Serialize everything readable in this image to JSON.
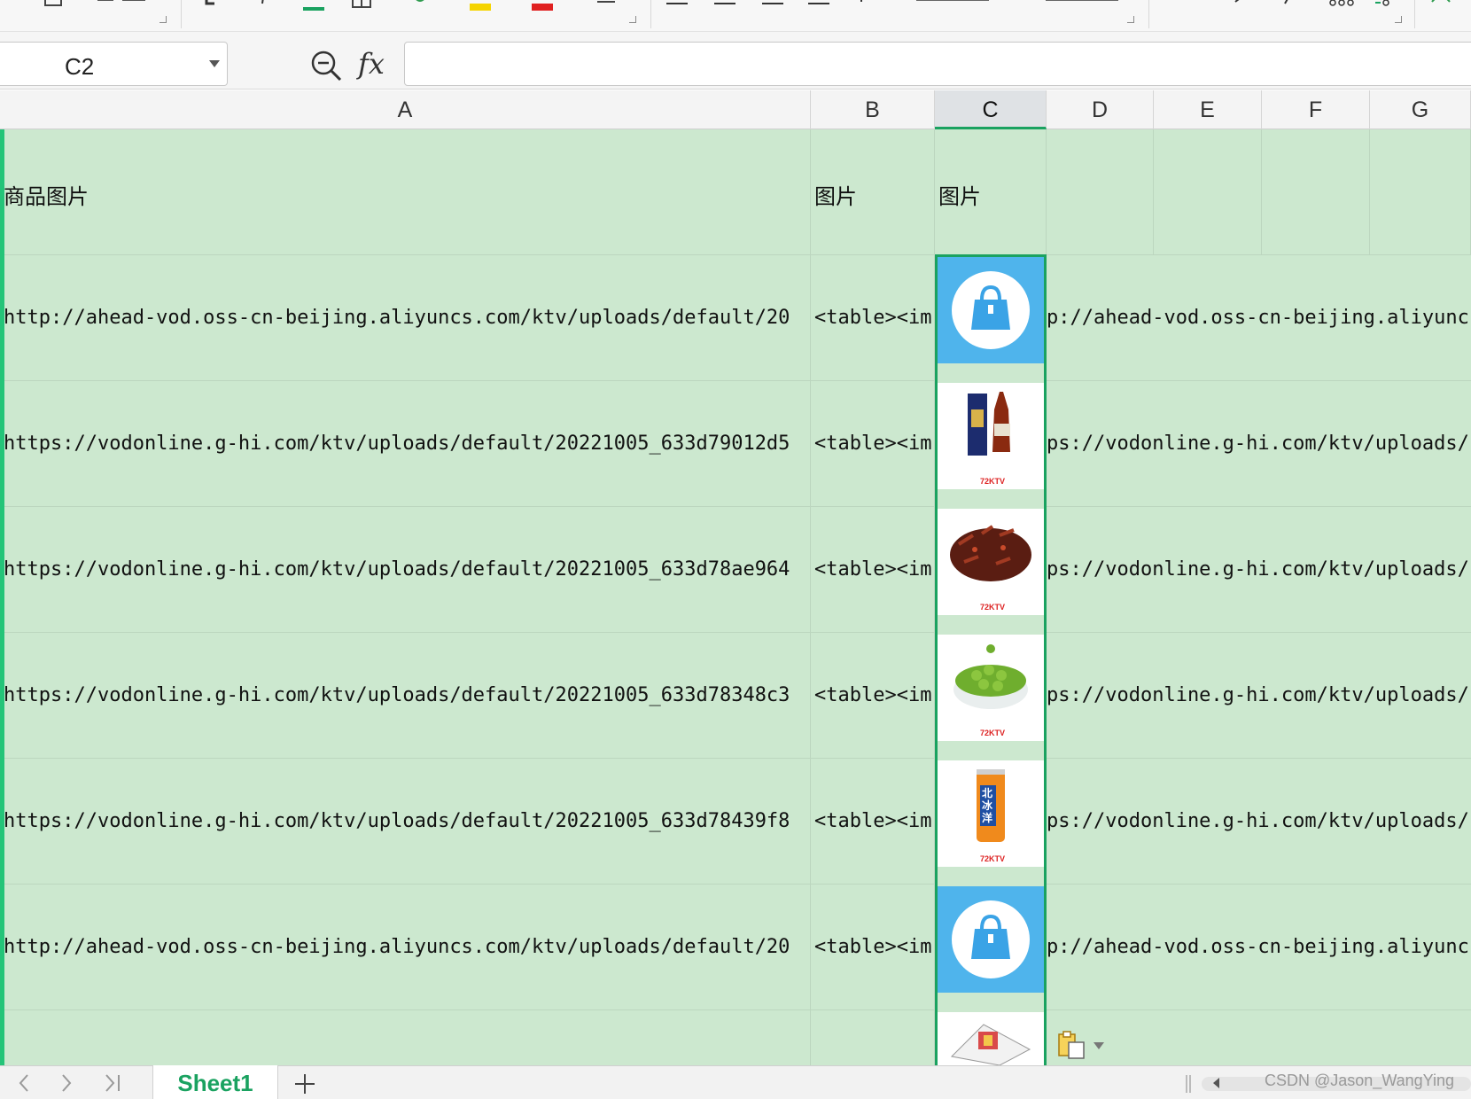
{
  "formula_bar": {
    "cell_ref": "C2",
    "fx_label": "fx",
    "formula_value": ""
  },
  "columns": [
    {
      "id": "A",
      "label": "A"
    },
    {
      "id": "B",
      "label": "B"
    },
    {
      "id": "C",
      "label": "C"
    },
    {
      "id": "D",
      "label": "D"
    },
    {
      "id": "E",
      "label": "E"
    },
    {
      "id": "F",
      "label": "F"
    },
    {
      "id": "G",
      "label": "G"
    }
  ],
  "selected_column": "C",
  "header_row": {
    "a": "商品图片",
    "b": "图片",
    "c": "图片"
  },
  "rows": [
    {
      "a": "http://ahead-vod.oss-cn-beijing.aliyuncs.com/ktv/uploads/default/20",
      "b": "<table><im",
      "d": "p://ahead-vod.oss-cn-beijing.aliyunc",
      "thumb": "bag"
    },
    {
      "a": "https://vodonline.g-hi.com/ktv/uploads/default/20221005_633d79012d5",
      "b": "<table><im",
      "d": "ps://vodonline.g-hi.com/ktv/uploads/",
      "thumb": "cognac"
    },
    {
      "a": "https://vodonline.g-hi.com/ktv/uploads/default/20221005_633d78ae964",
      "b": "<table><im",
      "d": "ps://vodonline.g-hi.com/ktv/uploads/",
      "thumb": "meat"
    },
    {
      "a": "https://vodonline.g-hi.com/ktv/uploads/default/20221005_633d78348c3",
      "b": "<table><im",
      "d": "ps://vodonline.g-hi.com/ktv/uploads/",
      "thumb": "peas"
    },
    {
      "a": "https://vodonline.g-hi.com/ktv/uploads/default/20221005_633d78439f8",
      "b": "<table><im",
      "d": "ps://vodonline.g-hi.com/ktv/uploads/",
      "thumb": "soda"
    },
    {
      "a": "http://ahead-vod.oss-cn-beijing.aliyuncs.com/ktv/uploads/default/20",
      "b": "<table><im",
      "d": "p://ahead-vod.oss-cn-beijing.aliyunc",
      "thumb": "bag"
    },
    {
      "a": "",
      "b": "",
      "d": "",
      "thumb": "cards"
    }
  ],
  "thumb_texts": {
    "soda_label": "北冰洋",
    "logo_tag": "72KTV"
  },
  "sheet_tabs": {
    "active": "Sheet1",
    "add_label": "+"
  },
  "watermark": "CSDN @Jason_WangYing",
  "colors": {
    "grid_fill": "#cce8cf",
    "accent_green": "#1aa260",
    "bag_blue": "#4fb4ec"
  }
}
